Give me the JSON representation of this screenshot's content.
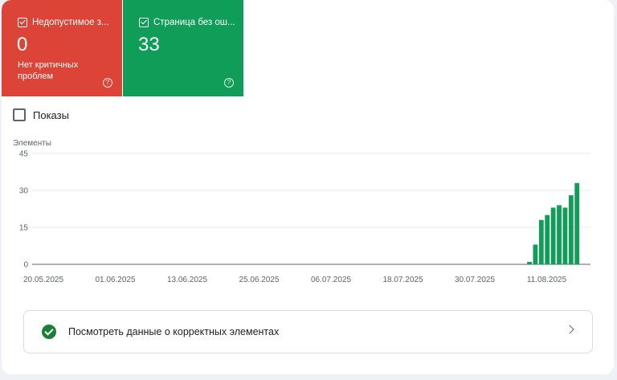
{
  "tiles": [
    {
      "title": "Недопустимое з...",
      "value": "0",
      "subtitle": "Нет критичных проблем",
      "color": "#db4437"
    },
    {
      "title": "Страница без ош...",
      "value": "33",
      "subtitle": "",
      "color": "#0f9d58"
    }
  ],
  "shows": {
    "label": "Показы"
  },
  "chart_data": {
    "type": "bar",
    "ylabel": "Элементы",
    "ylim": [
      0,
      45
    ],
    "yticks": [
      0,
      15,
      30,
      45
    ],
    "xticks": [
      "20.05.2025",
      "01.06.2025",
      "13.06.2025",
      "25.06.2025",
      "06.07.2025",
      "18.07.2025",
      "30.07.2025",
      "11.08.2025"
    ],
    "x": [
      "08.08.2025",
      "09.08.2025",
      "10.08.2025",
      "11.08.2025",
      "12.08.2025",
      "13.08.2025",
      "14.08.2025",
      "15.08.2025",
      "16.08.2025",
      "17.08.2025"
    ],
    "values": [
      1,
      8,
      18,
      20,
      23,
      24,
      23,
      28,
      33,
      0
    ],
    "color": "#0f9d58",
    "grid": true
  },
  "correct_link": {
    "label": "Посмотреть данные о корректных элементах"
  }
}
